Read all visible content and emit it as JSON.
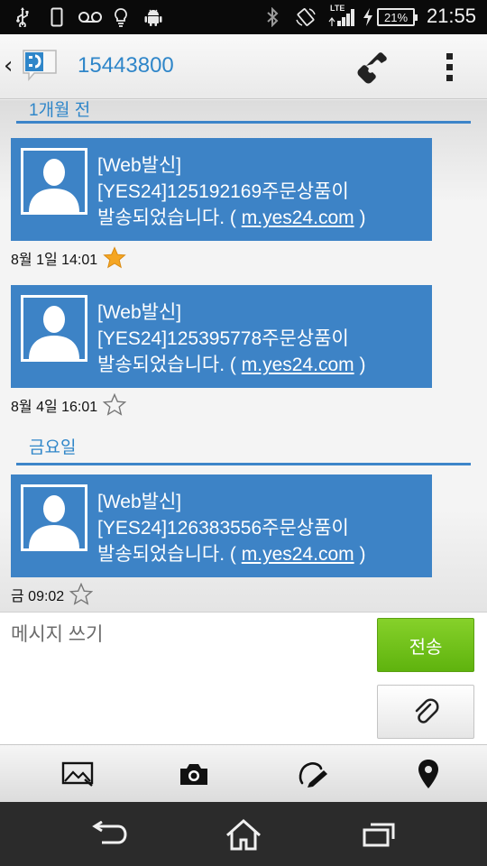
{
  "status_bar": {
    "time": "21:55",
    "battery": "21%",
    "network": "LTE",
    "left_icons": [
      "usb-icon",
      "phone-storage-icon",
      "voicemail-icon",
      "bulb-icon",
      "android-icon"
    ],
    "right_icons": [
      "bluetooth-icon",
      "rotate-icon",
      "signal-icon",
      "charging-icon",
      "battery-icon"
    ]
  },
  "header": {
    "contact": "15443800",
    "icons": [
      "back-chevron-icon",
      "messaging-app-icon",
      "phone-icon",
      "overflow-menu-icon"
    ]
  },
  "conversation": {
    "groups": [
      {
        "date_label": "1개월 전",
        "messages": [
          {
            "line1": "[Web발신]",
            "line2": "[YES24]125192169주문상품이",
            "line3_prefix": "발송되었습니다. ( ",
            "link": "m.yes24.com",
            "line3_suffix": " )",
            "time": "8월 1일 14:01",
            "starred": true
          },
          {
            "line1": "[Web발신]",
            "line2": "[YES24]125395778주문상품이",
            "line3_prefix": "발송되었습니다. ( ",
            "link": "m.yes24.com",
            "line3_suffix": " )",
            "time": "8월 4일 16:01",
            "starred": false
          }
        ]
      },
      {
        "date_label": "금요일",
        "messages": [
          {
            "line1": "[Web발신]",
            "line2": "[YES24]126383556주문상품이",
            "line3_prefix": "발송되었습니다. ( ",
            "link": "m.yes24.com",
            "line3_suffix": " )",
            "time": "금 09:02",
            "starred": false
          }
        ]
      }
    ]
  },
  "compose": {
    "placeholder": "메시지 쓰기",
    "send_label": "전송"
  },
  "attach_toolbar": [
    "image-icon",
    "camera-icon",
    "sketch-icon",
    "location-pin-icon"
  ],
  "nav_bar": [
    "back-icon",
    "home-icon",
    "recents-icon"
  ],
  "colors": {
    "accent": "#2f86c9",
    "bubble": "#3d83c6",
    "send": "#6cc11a",
    "star_filled": "#f5a623"
  }
}
